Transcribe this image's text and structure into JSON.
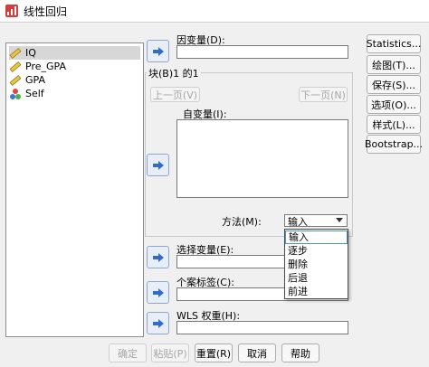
{
  "window": {
    "title": "线性回归"
  },
  "variables": [
    {
      "name": "IQ",
      "icon": "ruler-icon",
      "selected": true
    },
    {
      "name": "Pre_GPA",
      "icon": "ruler-icon",
      "selected": false
    },
    {
      "name": "GPA",
      "icon": "ruler-icon",
      "selected": false
    },
    {
      "name": "Self",
      "icon": "nominal-icon",
      "selected": false
    }
  ],
  "dependent": {
    "label": "因变量(D):",
    "value": ""
  },
  "block": {
    "title": "块(B)1 的1",
    "prev_label": "上一页(V)",
    "next_label": "下一页(N)",
    "independent_label": "自变量(I):"
  },
  "method": {
    "label": "方法(M):",
    "selected": "输入",
    "options": [
      "输入",
      "逐步",
      "删除",
      "后退",
      "前进"
    ]
  },
  "selection_variable": {
    "label": "选择变量(E):"
  },
  "case_labels": {
    "label": "个案标签(C):"
  },
  "wls_weight": {
    "label": "WLS 权重(H):"
  },
  "right_buttons": [
    "Statistics...",
    "绘图(T)...",
    "保存(S)...",
    "选项(O)...",
    "样式(L)...",
    "Bootstrap..."
  ],
  "bottom_buttons": {
    "ok": "确定",
    "paste": "粘贴(P)",
    "reset": "重置(R)",
    "cancel": "取消",
    "help": "帮助"
  },
  "colors": {
    "accent": "#2f6bd1",
    "selection": "#d7d7d7",
    "window_bg": "#f0f0f0"
  }
}
